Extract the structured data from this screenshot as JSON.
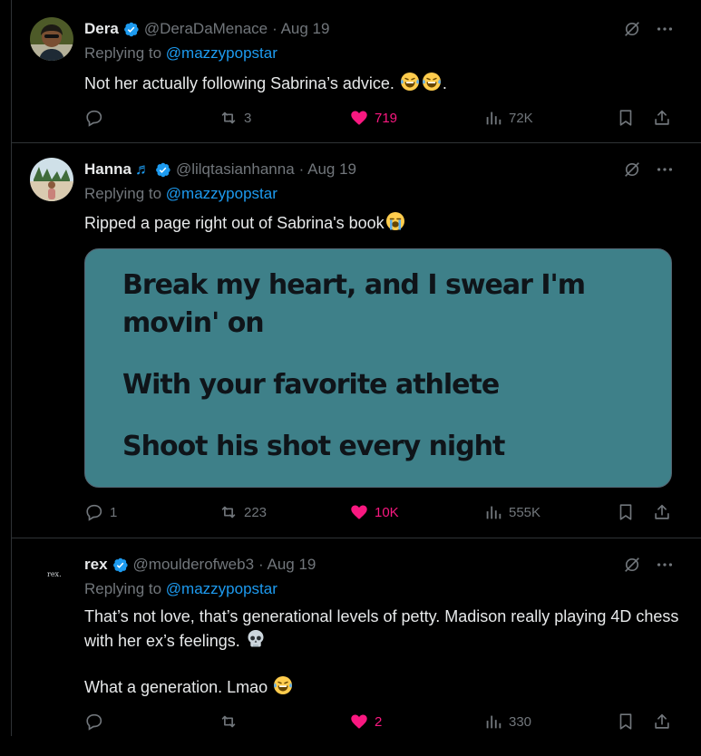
{
  "tweets": [
    {
      "name": "Dera",
      "handle": "@DeraDaMenace",
      "date": "· Aug 19",
      "replying_prefix": "Replying to",
      "replying_to": "@mazzypopstar",
      "text": "Not her actually following Sabrina’s advice. ",
      "emoji": [
        "laughing-tears",
        "laughing-tears"
      ],
      "text_suffix": ".",
      "stats": {
        "replies": "",
        "retweets": "3",
        "likes": "719",
        "views": "72K"
      }
    },
    {
      "name": "Hanna",
      "name_emoji": "♬",
      "handle": "@lilqtasianhanna",
      "date": "· Aug 19",
      "replying_prefix": "Replying to",
      "replying_to": "@mazzypopstar",
      "text": "Ripped a page right out of Sabrina's book",
      "emoji": [
        "loudly-crying"
      ],
      "image_lyrics": [
        "Break my heart, and I swear I'm",
        "movin' on",
        "With your favorite athlete",
        "Shoot his shot every night"
      ],
      "stats": {
        "replies": "1",
        "retweets": "223",
        "likes": "10K",
        "views": "555K"
      }
    },
    {
      "name": "rex",
      "handle": "@moulderofweb3",
      "date": "· Aug 19",
      "replying_prefix": "Replying to",
      "replying_to": "@mazzypopstar",
      "avatar_text": "rex.",
      "text_lines": [
        "That’s not love, that’s generational levels of petty. Madison really playing 4D chess with her ex’s feelings. "
      ],
      "emoji": [
        "skull",
        "laughing-tears"
      ],
      "text2": "What a generation. Lmao ",
      "stats": {
        "replies": "",
        "retweets": "",
        "likes": "2",
        "views": "330"
      }
    }
  ],
  "colors": {
    "accent": "#1d9bf0",
    "like": "#f91880",
    "muted": "#71767b",
    "text": "#e7e9ea",
    "image_bg": "#3e8089"
  }
}
